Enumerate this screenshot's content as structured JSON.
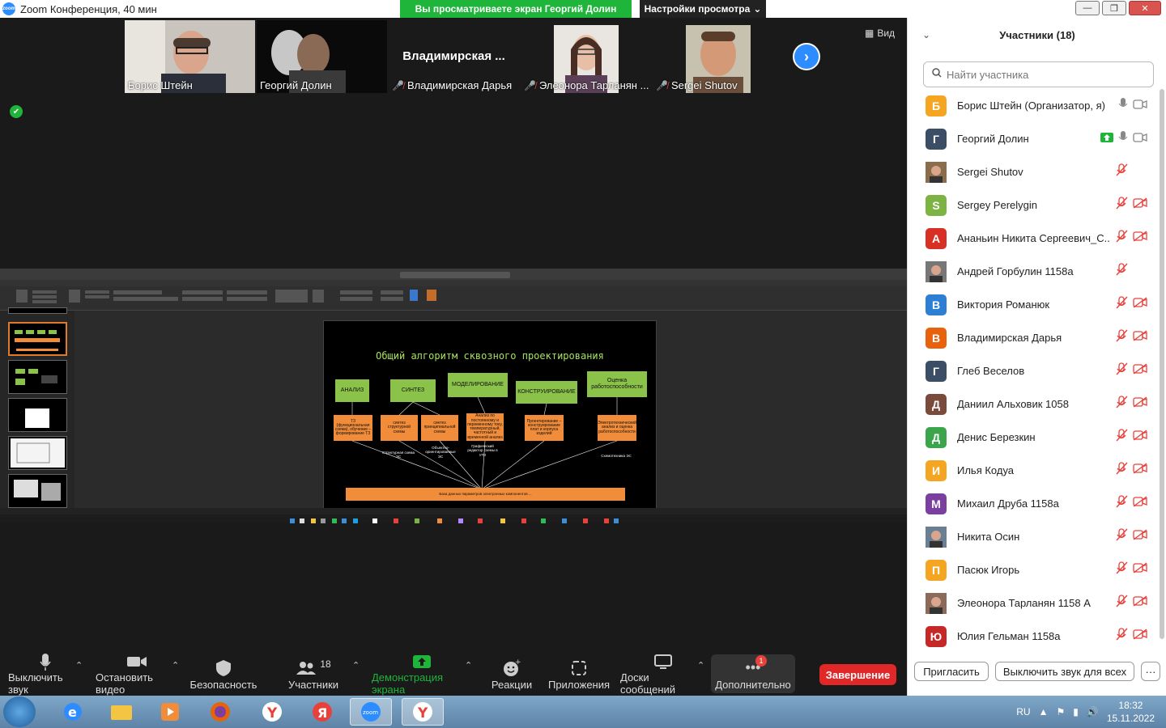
{
  "window": {
    "title": "Zoom Конференция, 40 мин",
    "share_banner": "Вы просматриваете экран Георгий Долин",
    "view_options": "Настройки просмотра"
  },
  "gallery": {
    "view_label": "Вид",
    "tiles": [
      {
        "name": "Борис Штейн",
        "muted": false,
        "video": true
      },
      {
        "name": "Георгий Долин",
        "muted": false,
        "video": true,
        "active_speaker": true
      },
      {
        "name": "Владимирская Дарья",
        "muted": true,
        "video": false,
        "big_name": "Владимирская ..."
      },
      {
        "name": "Элеонора Тарланян ...",
        "muted": true,
        "video": true
      },
      {
        "name": "Sergei Shutov",
        "muted": true,
        "video": true
      }
    ]
  },
  "slide": {
    "title": "Общий алгоритм сквозного проектирования",
    "stages": [
      "АНАЛИЗ",
      "СИНТЕЗ",
      "МОДЕЛИРОВАНИЕ",
      "КОНСТРУИРОВАНИЕ",
      "Оценка работоспособности"
    ],
    "details": [
      "ТЗ (функциональная схема), обучение – формирование ТЗ",
      "синтез структурной схемы",
      "синтез принципиальной схемы",
      "Анализ по постоянному и переменному току, температурный, частотный и временной анализ",
      "Проектирование – конструирование плат и корпуса изделий",
      "Электротехнический анализ и оценка работоспособности"
    ],
    "notes": [
      "Структурная схема ЭС",
      "Объектно-ориентированные ЭС",
      "Графический редактор схемы в УГО",
      "Схемотехника ЭС"
    ],
    "bottom_bar": "База данных параметров электронных компонентов ..."
  },
  "toolbar": {
    "mute": "Выключить звук",
    "video": "Остановить видео",
    "security": "Безопасность",
    "participants": "Участники",
    "participants_count": "18",
    "share": "Демонстрация экрана",
    "reactions": "Реакции",
    "apps": "Приложения",
    "whiteboards": "Доски сообщений",
    "more": "Дополнительно",
    "more_badge": "1",
    "end": "Завершение"
  },
  "panel": {
    "title": "Участники (18)",
    "search_placeholder": "Найти участника",
    "invite": "Пригласить",
    "mute_all": "Выключить звук для всех",
    "more": "···",
    "participants": [
      {
        "name": "Борис Штейн (Организатор, я)",
        "initial": "Б",
        "color": "#f4a623",
        "mic": "on",
        "video": "on"
      },
      {
        "name": "Георгий Долин",
        "initial": "Г",
        "color": "#3b4e66",
        "mic": "on",
        "video": "on",
        "sharing": true
      },
      {
        "name": "Sergei Shutov",
        "initial": "",
        "color": "#8a6d4b",
        "mic": "off",
        "video": "none",
        "photo": true
      },
      {
        "name": "Sergey Perelygin",
        "initial": "S",
        "color": "#7cb342",
        "mic": "off",
        "video": "off"
      },
      {
        "name": "Ананьин Никита Сергеевич_С...",
        "initial": "А",
        "color": "#d93025",
        "mic": "off",
        "video": "off"
      },
      {
        "name": "Андрей Горбулин 1158а",
        "initial": "",
        "color": "#777777",
        "mic": "off",
        "video": "none",
        "photo": true
      },
      {
        "name": "Виктория Романюк",
        "initial": "В",
        "color": "#2d7fd3",
        "mic": "off",
        "video": "off"
      },
      {
        "name": "Владимирская Дарья",
        "initial": "В",
        "color": "#e8620d",
        "mic": "off",
        "video": "off"
      },
      {
        "name": "Глеб Веселов",
        "initial": "Г",
        "color": "#3b4e66",
        "mic": "off",
        "video": "off"
      },
      {
        "name": "Даниил Альховик 1058",
        "initial": "Д",
        "color": "#7a4a3a",
        "mic": "off",
        "video": "off"
      },
      {
        "name": "Денис Березкин",
        "initial": "Д",
        "color": "#3aa54a",
        "mic": "off",
        "video": "off"
      },
      {
        "name": "Илья Кодуа",
        "initial": "И",
        "color": "#f4a623",
        "mic": "off",
        "video": "off"
      },
      {
        "name": "Михаил Друба 1158а",
        "initial": "М",
        "color": "#7b3fa0",
        "mic": "off",
        "video": "off"
      },
      {
        "name": "Никита Осин",
        "initial": "",
        "color": "#6b7f94",
        "mic": "off",
        "video": "off",
        "photo": true
      },
      {
        "name": "Пасюк Игорь",
        "initial": "П",
        "color": "#f4a623",
        "mic": "off",
        "video": "off"
      },
      {
        "name": "Элеонора Тарланян 1158 А",
        "initial": "",
        "color": "#8c6a5a",
        "mic": "off",
        "video": "off",
        "photo": true
      },
      {
        "name": "Юлия Гельман 1158а",
        "initial": "Ю",
        "color": "#c62828",
        "mic": "off",
        "video": "off"
      }
    ]
  },
  "taskbar": {
    "lang": "RU",
    "time": "18:32",
    "date": "15.11.2022"
  }
}
